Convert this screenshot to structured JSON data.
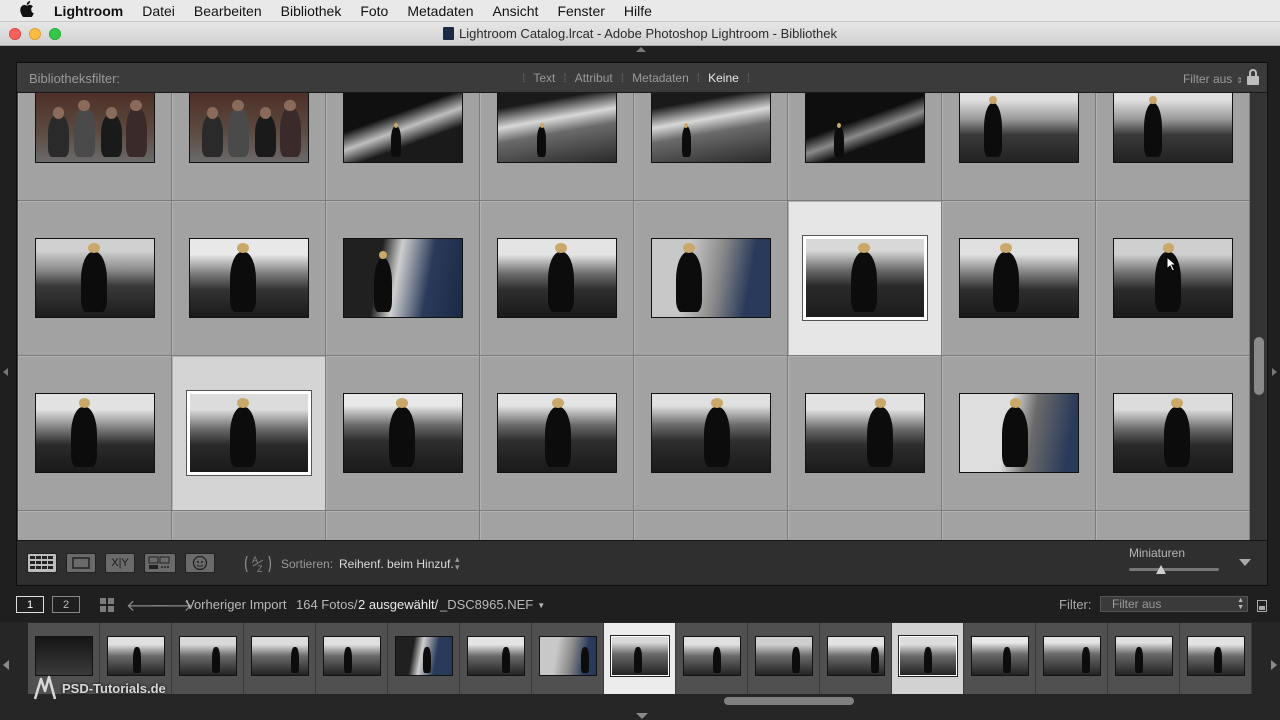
{
  "menubar": {
    "apple": "",
    "items": [
      "Lightroom",
      "Datei",
      "Bearbeiten",
      "Bibliothek",
      "Foto",
      "Metadaten",
      "Ansicht",
      "Fenster",
      "Hilfe"
    ]
  },
  "window": {
    "title": "Lightroom Catalog.lrcat - Adobe Photoshop Lightroom - Bibliothek"
  },
  "filterbar": {
    "label": "Bibliotheksfilter:",
    "options": [
      "Text",
      "Attribut",
      "Metadaten",
      "Keine"
    ],
    "active_option": "Keine",
    "preset": "Filter aus"
  },
  "toolbar": {
    "compare_label": "X|Y",
    "sort_label": "Sortieren:",
    "sort_value": "Reihenf. beim Hinzuf.",
    "thumbnails_label": "Miniaturen",
    "thumbnail_size_fraction": 0.35
  },
  "filmstrip_bar": {
    "screen1": "1",
    "screen2": "2",
    "source": "Vorheriger Import",
    "count": "164 Fotos/",
    "selected": "2 ausgewählt/",
    "file": "_DSC8965.NEF",
    "filter_label": "Filter:",
    "filter_value": "Filter aus"
  },
  "watermark": "PSD-Tutorials.de",
  "colors": {
    "cell_bg": "#a2a2a2",
    "cell_selected": "#e6e6e6",
    "cell_selected_secondary": "#d4d4d4",
    "app_bg": "#1f1f1f"
  }
}
